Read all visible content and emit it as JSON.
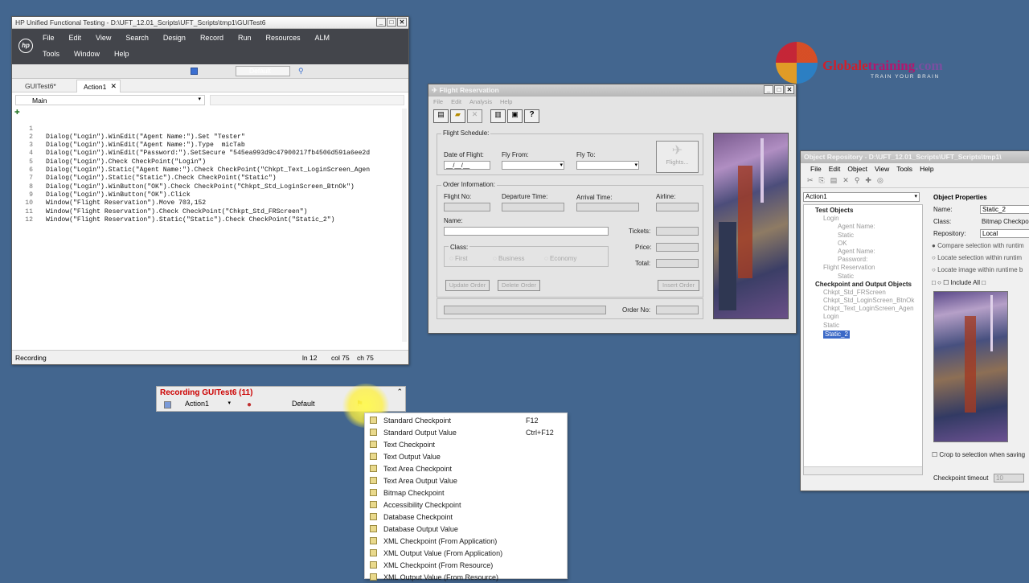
{
  "uft": {
    "title": "HP Unified Functional Testing - D:\\UFT_12.01_Scripts\\UFT_Scripts\\tmp1\\GUITest6",
    "menu1": [
      "File",
      "Edit",
      "View",
      "Search",
      "Design",
      "Record",
      "Run",
      "Resources",
      "ALM"
    ],
    "menu2": [
      "Tools",
      "Window",
      "Help"
    ],
    "env": "Default",
    "tabs": [
      "GUITest6*",
      "Action1"
    ],
    "scope": "Main",
    "lines": [
      "Dialog(\"Login\").WinEdit(\"Agent Name:\").Set \"Tester\"",
      "Dialog(\"Login\").WinEdit(\"Agent Name:\").Type  micTab",
      "Dialog(\"Login\").WinEdit(\"Password:\").SetSecure \"545ea993d9c47900217fb4506d591a6ee2d",
      "Dialog(\"Login\").Check CheckPoint(\"Login\")",
      "Dialog(\"Login\").Static(\"Agent Name:\").Check CheckPoint(\"Chkpt_Text_LoginScreen_Agen",
      "Dialog(\"Login\").Static(\"Static\").Check CheckPoint(\"Static\")",
      "Dialog(\"Login\").WinButton(\"OK\").Check CheckPoint(\"Chkpt_Std_LoginScreen_BtnOk\")",
      "Dialog(\"Login\").WinButton(\"OK\").Click",
      "Window(\"Flight Reservation\").Move 703,152",
      "Window(\"Flight Reservation\").Check CheckPoint(\"Chkpt_Std_FRScreen\")",
      "Window(\"Flight Reservation\").Static(\"Static\").Check CheckPoint(\"Static_2\")"
    ],
    "line_numbers": [
      "1",
      "2",
      "3",
      "4",
      "5",
      "6",
      "7",
      "8",
      "9",
      "10",
      "11",
      "12"
    ],
    "status": "Recording",
    "ln": "ln 12",
    "col": "col 75",
    "ch": "ch 75"
  },
  "flight": {
    "title": "Flight Reservation",
    "menu": [
      "File",
      "Edit",
      "Analysis",
      "Help"
    ],
    "schedule": "Flight Schedule:",
    "date_label": "Date of Flight:",
    "date_value": "__/__/__",
    "fly_from": "Fly From:",
    "fly_to": "Fly To:",
    "flights_btn": "Flights...",
    "order_info": "Order Information:",
    "flight_no": "Flight No:",
    "dep_time": "Departure Time:",
    "arr_time": "Arrival Time:",
    "airline": "Airline:",
    "name": "Name:",
    "tickets": "Tickets:",
    "price": "Price:",
    "total": "Total:",
    "class": "Class:",
    "classes": [
      "First",
      "Business",
      "Economy"
    ],
    "update": "Update Order",
    "delete": "Delete Order",
    "insert": "Insert Order",
    "order_no": "Order No:"
  },
  "recbar": {
    "title": "Recording GUITest6 (11)",
    "action": "Action1",
    "env": "Default"
  },
  "dropdown": [
    {
      "label": "Standard Checkpoint",
      "shortcut": "F12"
    },
    {
      "label": "Standard Output Value",
      "shortcut": "Ctrl+F12"
    },
    {
      "label": "Text Checkpoint"
    },
    {
      "label": "Text Output Value"
    },
    {
      "label": "Text Area Checkpoint"
    },
    {
      "label": "Text Area Output Value"
    },
    {
      "label": "Bitmap Checkpoint"
    },
    {
      "label": "Accessibility Checkpoint"
    },
    {
      "label": "Database Checkpoint"
    },
    {
      "label": "Database Output Value"
    },
    {
      "label": "XML Checkpoint (From Application)"
    },
    {
      "label": "XML Output Value (From Application)"
    },
    {
      "label": "XML Checkpoint (From Resource)"
    },
    {
      "label": "XML Output Value (From Resource)"
    }
  ],
  "repo": {
    "title": "Object Repository - D:\\UFT_12.01_Scripts\\UFT_Scripts\\tmp1\\",
    "menu": [
      "File",
      "Edit",
      "Object",
      "View",
      "Tools",
      "Help"
    ],
    "action": "Action1",
    "tree": [
      "Test Objects",
      "Login",
      "Agent Name:",
      "Static",
      "OK",
      "Agent Name:",
      "Password:",
      "Flight Reservation",
      "Static",
      "Checkpoint and Output Objects",
      "Chkpt_Std_FRScreen",
      "Chkpt_Std_LoginScreen_BtnOk",
      "Chkpt_Text_LoginScreen_Agen",
      "Login",
      "Static",
      "Static_2"
    ],
    "props_title": "Object Properties",
    "name_label": "Name:",
    "name_value": "Static_2",
    "class_label": "Class:",
    "class_value": "Bitmap Checkpo",
    "repo_label": "Repository:",
    "repo_value": "Local",
    "opt1": "Compare selection with runtim",
    "opt2": "Locate selection within runtim",
    "opt3": "Locate image within runtime b",
    "include_all": "Include All",
    "crop": "Crop to selection when saving",
    "timeout_label": "Checkpoint timeout",
    "timeout_value": "10"
  },
  "logo": {
    "text_a": "Global",
    "text_b": "e",
    "text_c": "training",
    "text_d": ".com",
    "tagline": "TRAIN YOUR BRAIN"
  }
}
